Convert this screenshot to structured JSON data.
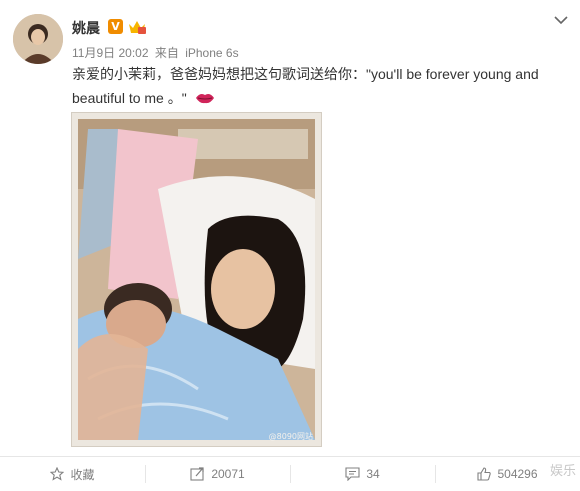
{
  "post": {
    "author": "姚晨",
    "vip_badge": "V",
    "date": "11月9日 20:02",
    "source_prefix": "来自",
    "source": "iPhone 6s",
    "text": "亲爱的小茉莉，爸爸妈妈想把这句歌词送给你：\"you'll be forever young and beautiful to me 。\"",
    "photo_watermark": "@8090网站"
  },
  "actions": {
    "favorite": "收藏",
    "repost_count": "20071",
    "comment_count": "34",
    "like_count": "504296"
  },
  "overlay": {
    "site_watermark": "娱乐"
  },
  "icons": [
    "avatar",
    "vip-badge-icon",
    "member-crown-icon",
    "chevron-down-icon",
    "lips-emoji-icon",
    "star-icon",
    "repost-icon",
    "comment-icon",
    "like-icon"
  ],
  "colors": {
    "vip_orange": "#f08c00",
    "lips_red": "#d0245a",
    "meta_gray": "#808080"
  }
}
